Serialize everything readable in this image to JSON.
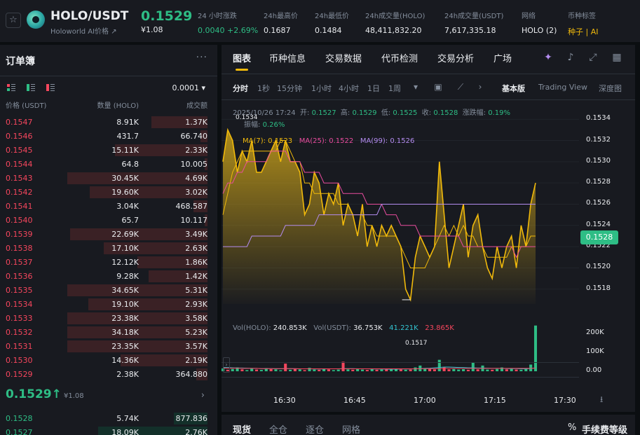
{
  "header": {
    "star_icon": "star-icon",
    "pair": "HOLO/USDT",
    "subtitle": "Holoworld AI价格 ↗",
    "price": "0.1529",
    "price_usd": "¥1.08",
    "stats": [
      {
        "label": "24 小时涨跌",
        "value": "0.0040 +2.69%",
        "tone": "g"
      },
      {
        "label": "24h最高价",
        "value": "0.1687",
        "tone": ""
      },
      {
        "label": "24h最低价",
        "value": "0.1484",
        "tone": ""
      },
      {
        "label": "24h成交量(HOLO)",
        "value": "48,411,832.20",
        "tone": ""
      },
      {
        "label": "24h成交量(USDT)",
        "value": "7,617,335.18",
        "tone": ""
      },
      {
        "label": "网络",
        "value": "HOLO (2)",
        "tone": ""
      },
      {
        "label": "币种标签",
        "value": "种子 | AI",
        "tone": "y"
      }
    ]
  },
  "orderbook": {
    "title": "订单簿",
    "more": "···",
    "tick": "0.0001 ▾",
    "headers": [
      "价格 (USDT)",
      "数量 (HOLO)",
      "成交额"
    ],
    "asks": [
      {
        "price": "0.1547",
        "amount": "8.91K",
        "total": "1.37K",
        "depth": 0.4
      },
      {
        "price": "0.1546",
        "amount": "431.7",
        "total": "66.740",
        "depth": 0.05
      },
      {
        "price": "0.1545",
        "amount": "15.11K",
        "total": "2.33K",
        "depth": 0.66
      },
      {
        "price": "0.1544",
        "amount": "64.8",
        "total": "10.005",
        "depth": 0.02
      },
      {
        "price": "0.1543",
        "amount": "30.45K",
        "total": "4.69K",
        "depth": 1.0
      },
      {
        "price": "0.1542",
        "amount": "19.60K",
        "total": "3.02K",
        "depth": 0.84
      },
      {
        "price": "0.1541",
        "amount": "3.04K",
        "total": "468.587",
        "depth": 0.1
      },
      {
        "price": "0.1540",
        "amount": "65.7",
        "total": "10.117",
        "depth": 0.02
      },
      {
        "price": "0.1539",
        "amount": "22.69K",
        "total": "3.49K",
        "depth": 0.98
      },
      {
        "price": "0.1538",
        "amount": "17.10K",
        "total": "2.63K",
        "depth": 0.74
      },
      {
        "price": "0.1537",
        "amount": "12.12K",
        "total": "1.86K",
        "depth": 0.5
      },
      {
        "price": "0.1536",
        "amount": "9.28K",
        "total": "1.42K",
        "depth": 0.42
      },
      {
        "price": "0.1535",
        "amount": "34.65K",
        "total": "5.31K",
        "depth": 1.0
      },
      {
        "price": "0.1534",
        "amount": "19.10K",
        "total": "2.93K",
        "depth": 0.85
      },
      {
        "price": "0.1533",
        "amount": "23.38K",
        "total": "3.58K",
        "depth": 1.0
      },
      {
        "price": "0.1532",
        "amount": "34.18K",
        "total": "5.23K",
        "depth": 1.0
      },
      {
        "price": "0.1531",
        "amount": "23.35K",
        "total": "3.57K",
        "depth": 1.0
      },
      {
        "price": "0.1530",
        "amount": "14.36K",
        "total": "2.19K",
        "depth": 0.62
      },
      {
        "price": "0.1529",
        "amount": "2.38K",
        "total": "364.880",
        "depth": 0.08
      }
    ],
    "mid_price": "0.1529↑",
    "mid_usd": "¥1.08",
    "mid_arrow": "›",
    "bids": [
      {
        "price": "0.1528",
        "amount": "5.74K",
        "total": "877.836",
        "depth": 0.24
      },
      {
        "price": "0.1527",
        "amount": "18.09K",
        "total": "2.76K",
        "depth": 0.78
      }
    ]
  },
  "chart_panel": {
    "tabs": [
      "图表",
      "币种信息",
      "交易数据",
      "代币检测",
      "交易分析",
      "广场"
    ],
    "tab_icons": [
      "ai-sparkle-icon",
      "bell-icon",
      "expand-icon",
      "grid-icon"
    ],
    "timeframes": [
      "分时",
      "1秒",
      "15分钟",
      "1小时",
      "4小时",
      "1日",
      "1周"
    ],
    "tools": [
      "chevron-down-icon",
      "calendar-icon",
      "indicator-icon",
      "chevron-right-icon"
    ],
    "views": [
      "基本版",
      "Trading View",
      "深度图"
    ],
    "legend": {
      "date": "2025/10/26 17:24",
      "open_label": "开:",
      "open": "0.1527",
      "high_label": "高:",
      "high": "0.1529",
      "low_label": "低:",
      "low": "0.1525",
      "close_label": "收:",
      "close": "0.1528",
      "chg_label": "涨跌幅:",
      "chg": "0.19%",
      "amp_label": "振幅:",
      "amp": "0.26%",
      "ma7": "MA(7): 0.1523",
      "ma25": "MA(25): 0.1522",
      "ma99": "MA(99): 0.1526"
    },
    "vol_legend": {
      "vol_holo": "Vol(HOLO):",
      "vol_holo_v": "240.853K",
      "vol_usdt": "Vol(USDT):",
      "vol_usdt_v": "36.753K",
      "v1": "41.221K",
      "v2": "23.865K"
    },
    "current_tag": "0.1528",
    "high_mark": "0.1534",
    "low_mark": "0.1517",
    "reset_icon": "reset-icon"
  },
  "chart_data": {
    "type": "area",
    "price_axis": [
      "0.1534",
      "0.1532",
      "0.1530",
      "0.1528",
      "0.1526",
      "0.1524",
      "0.1522",
      "0.1520",
      "0.1518"
    ],
    "volume_axis": [
      "200K",
      "100K",
      "0.00"
    ],
    "time_axis": [
      "16:30",
      "16:45",
      "17:00",
      "17:15",
      "17:30"
    ],
    "ylim": [
      0.15166,
      0.15352
    ],
    "price": [
      0.153,
      0.1533,
      0.1532,
      0.1529,
      0.1531,
      0.153,
      0.1532,
      0.1529,
      0.1529,
      0.153,
      0.1531,
      0.1532,
      0.153,
      0.1532,
      0.153,
      0.153,
      0.1529,
      0.1525,
      0.1526,
      0.1529,
      0.1528,
      0.1525,
      0.1527,
      0.1526,
      0.1528,
      0.1524,
      0.1526,
      0.1525,
      0.1523,
      0.1526,
      0.1522,
      0.1524,
      0.1522,
      0.1524,
      0.1523,
      0.1524,
      0.1523,
      0.1522,
      0.1518,
      0.1517,
      0.1521,
      0.1523,
      0.1522,
      0.1521,
      0.1522,
      0.153,
      0.1525,
      0.152,
      0.1522,
      0.1524,
      0.1526,
      0.1521,
      0.1524,
      0.1525,
      0.1522,
      0.152,
      0.1519,
      0.1522,
      0.152,
      0.1522,
      0.1523,
      0.152,
      0.1524,
      0.1522,
      0.1526,
      0.1528
    ],
    "ma7": [
      0.1525,
      0.1527,
      0.1529,
      0.153,
      0.1531,
      0.1531,
      0.1531,
      0.1531,
      0.1531,
      0.1531,
      0.1531,
      0.1531,
      0.1532,
      0.1532,
      0.1531,
      0.153,
      0.153,
      0.1528,
      0.1528,
      0.1527,
      0.1527,
      0.1527,
      0.1527,
      0.1527,
      0.1526,
      0.1526,
      0.1526,
      0.1525,
      0.1525,
      0.1525,
      0.1524,
      0.1524,
      0.1523,
      0.1523,
      0.1523,
      0.1523,
      0.1523,
      0.1522,
      0.1521,
      0.152,
      0.152,
      0.152,
      0.152,
      0.1521,
      0.1522,
      0.1523,
      0.1524,
      0.1523,
      0.1524,
      0.1523,
      0.1524,
      0.1523,
      0.1523,
      0.1522,
      0.1522,
      0.1521,
      0.1521,
      0.1521,
      0.1521,
      0.1521,
      0.1522,
      0.1522,
      0.1522,
      0.1522,
      0.1523,
      0.1523
    ],
    "ma25": [
      0.1527,
      0.1528,
      0.1528,
      0.1529,
      0.1529,
      0.153,
      0.153,
      0.153,
      0.153,
      0.153,
      0.1531,
      0.1531,
      0.1531,
      0.1531,
      0.153,
      0.153,
      0.153,
      0.1529,
      0.1529,
      0.1529,
      0.1529,
      0.1528,
      0.1528,
      0.1528,
      0.1528,
      0.1527,
      0.1527,
      0.1527,
      0.1527,
      0.1527,
      0.1526,
      0.1526,
      0.1526,
      0.1526,
      0.1525,
      0.1525,
      0.1525,
      0.1524,
      0.1524,
      0.1524,
      0.1524,
      0.1523,
      0.1523,
      0.1523,
      0.1523,
      0.1523,
      0.1523,
      0.1523,
      0.1523,
      0.1523,
      0.1522,
      0.1522,
      0.1522,
      0.1522,
      0.1522,
      0.1522,
      0.1522,
      0.1522,
      0.1522,
      0.1522,
      0.1522,
      0.1521,
      0.1522,
      0.1522,
      0.1522,
      0.1522
    ],
    "ma99": [
      0.1522,
      0.1522,
      0.1522,
      0.1522,
      0.1522,
      0.1522,
      0.1523,
      0.1523,
      0.1523,
      0.1523,
      0.1523,
      0.1523,
      0.1523,
      0.1524,
      0.1524,
      0.1524,
      0.1524,
      0.1524,
      0.1524,
      0.1524,
      0.1525,
      0.1525,
      0.1525,
      0.1525,
      0.1525,
      0.1525,
      0.1525,
      0.1525,
      0.1525,
      0.1525,
      0.1525,
      0.1525,
      0.1525,
      0.1526,
      0.1526,
      0.1526,
      0.1526,
      0.1526,
      0.1526,
      0.1526,
      0.1526,
      0.1526,
      0.1526,
      0.1526,
      0.1526,
      0.1526,
      0.1526,
      0.1526,
      0.1526,
      0.1526,
      0.1526,
      0.1526,
      0.1526,
      0.1526,
      0.1526,
      0.1526,
      0.1526,
      0.1526,
      0.1526,
      0.1526,
      0.1526,
      0.1526,
      0.1526,
      0.1526,
      0.1526,
      0.1526
    ],
    "volume": [
      15,
      8,
      12,
      20,
      10,
      6,
      14,
      9,
      7,
      16,
      11,
      10,
      5,
      40,
      8,
      12,
      10,
      6,
      18,
      9,
      8,
      14,
      10,
      6,
      9,
      50,
      10,
      8,
      12,
      9,
      7,
      11,
      8,
      10,
      9,
      12,
      14,
      10,
      8,
      9,
      20,
      30,
      15,
      12,
      10,
      60,
      20,
      10,
      12,
      9,
      11,
      8,
      45,
      10,
      30,
      9,
      8,
      12,
      20,
      10,
      15,
      9,
      8,
      12,
      35,
      240
    ],
    "volume_up": [
      1,
      0,
      1,
      1,
      0,
      1,
      1,
      0,
      1,
      1,
      0,
      1,
      1,
      0,
      1,
      0,
      1,
      0,
      1,
      1,
      0,
      1,
      0,
      1,
      1,
      0,
      1,
      0,
      1,
      1,
      0,
      1,
      0,
      1,
      0,
      1,
      1,
      0,
      1,
      0,
      1,
      1,
      1,
      0,
      0,
      1,
      0,
      0,
      1,
      1,
      1,
      0,
      1,
      0,
      1,
      1,
      0,
      1,
      1,
      0,
      1,
      0,
      1,
      1,
      1,
      1
    ],
    "vol_ma1": [
      20,
      19,
      18,
      17,
      17,
      16,
      15,
      15,
      14,
      14,
      14,
      13,
      13,
      14,
      14,
      13,
      13,
      13,
      13,
      12,
      12,
      12,
      13,
      13,
      13,
      14,
      14,
      14,
      13,
      13,
      13,
      12,
      12,
      12,
      11,
      11,
      11,
      12,
      12,
      12,
      13,
      14,
      15,
      16,
      18,
      20,
      22,
      22,
      21,
      20,
      19,
      18,
      18,
      17,
      17,
      16,
      15,
      15,
      15,
      14,
      14,
      14,
      13,
      13,
      14,
      18
    ],
    "vol_ma2": [
      16,
      16,
      16,
      16,
      15,
      15,
      15,
      15,
      14,
      14,
      14,
      14,
      14,
      14,
      14,
      14,
      13,
      13,
      13,
      13,
      13,
      13,
      13,
      13,
      13,
      13,
      13,
      13,
      13,
      13,
      13,
      13,
      13,
      13,
      13,
      13,
      13,
      13,
      13,
      13,
      13,
      13,
      14,
      14,
      14,
      14,
      15,
      15,
      15,
      15,
      15,
      15,
      15,
      15,
      15,
      15,
      15,
      15,
      15,
      15,
      15,
      15,
      15,
      15,
      15,
      16
    ]
  },
  "bottom_bar": {
    "tabs": [
      "现货",
      "全仓",
      "逐仓",
      "网格"
    ],
    "percent": "%",
    "fee": "手续费等级"
  }
}
